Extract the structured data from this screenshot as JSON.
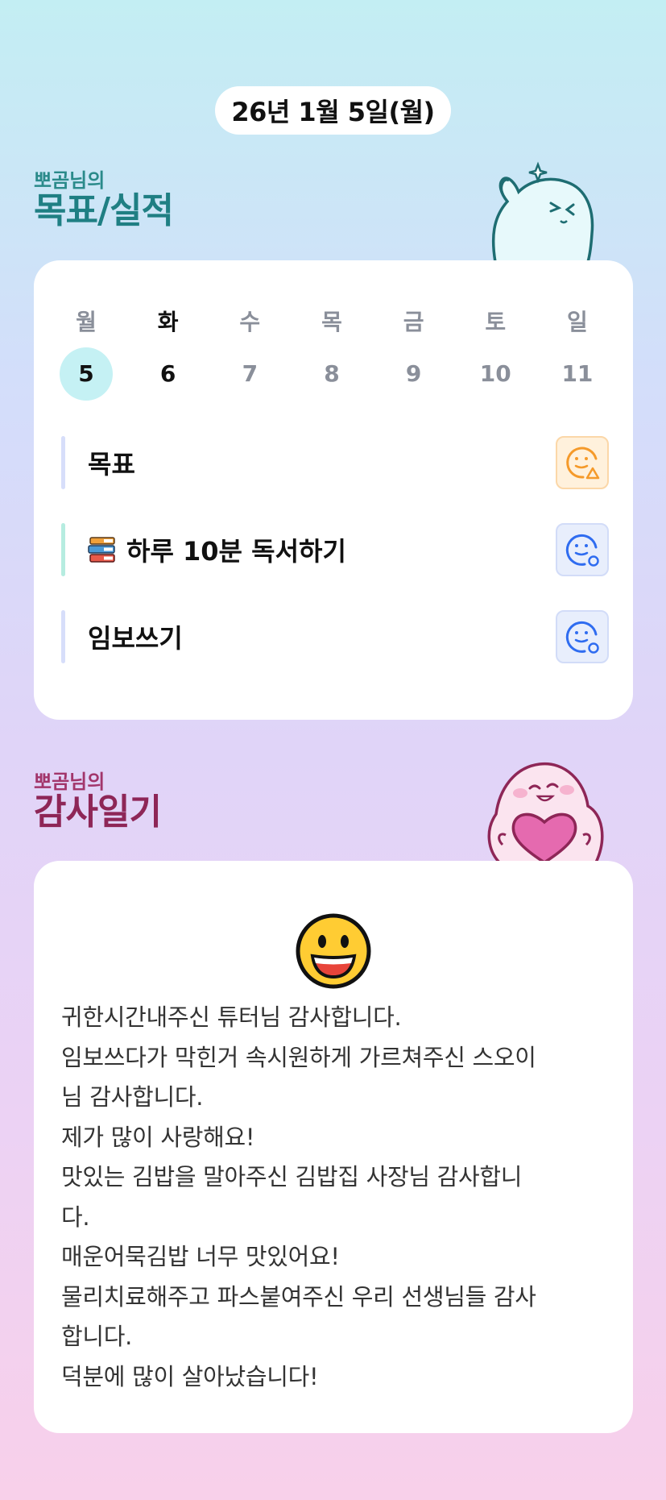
{
  "date_label": "26년 1월 5일(월)",
  "goal_section": {
    "prefix": "뽀곰님의",
    "title": "목표/실적"
  },
  "week": {
    "day_names": [
      "월",
      "화",
      "수",
      "목",
      "금",
      "토",
      "일"
    ],
    "day_numbers": [
      "5",
      "6",
      "7",
      "8",
      "9",
      "10",
      "11"
    ],
    "selected_index": 0,
    "today_index": 1
  },
  "goals": [
    {
      "label": "목표",
      "icon": "smile-triangle-icon",
      "status_color": "#f59a2a"
    },
    {
      "label": "하루 10분 독서하기",
      "icon": "smile-circle-icon",
      "prefix_icon": "books-icon",
      "status_color": "#2f6cf0"
    },
    {
      "label": "임보쓰기",
      "icon": "smile-circle-icon",
      "status_color": "#2f6cf0"
    }
  ],
  "diary_section": {
    "prefix": "뽀곰님의",
    "title": "감사일기",
    "mood_icon": "grinning-face-icon",
    "lines": [
      "귀한시간내주신 튜터님 감사합니다.",
      "임보쓰다가 막힌거 속시원하게 가르쳐주신 스오이",
      "님 감사합니다.",
      "제가 많이 사랑해요!",
      "맛있는 김밥을 말아주신 김밥집 사장님 감사합니",
      "다.",
      "매운어묵김밥 너무 맛있어요!",
      "물리치료해주고 파스붙여주신 우리 선생님들 감사",
      "합니다.",
      "덕분에 많이 살아났습니다!"
    ]
  }
}
